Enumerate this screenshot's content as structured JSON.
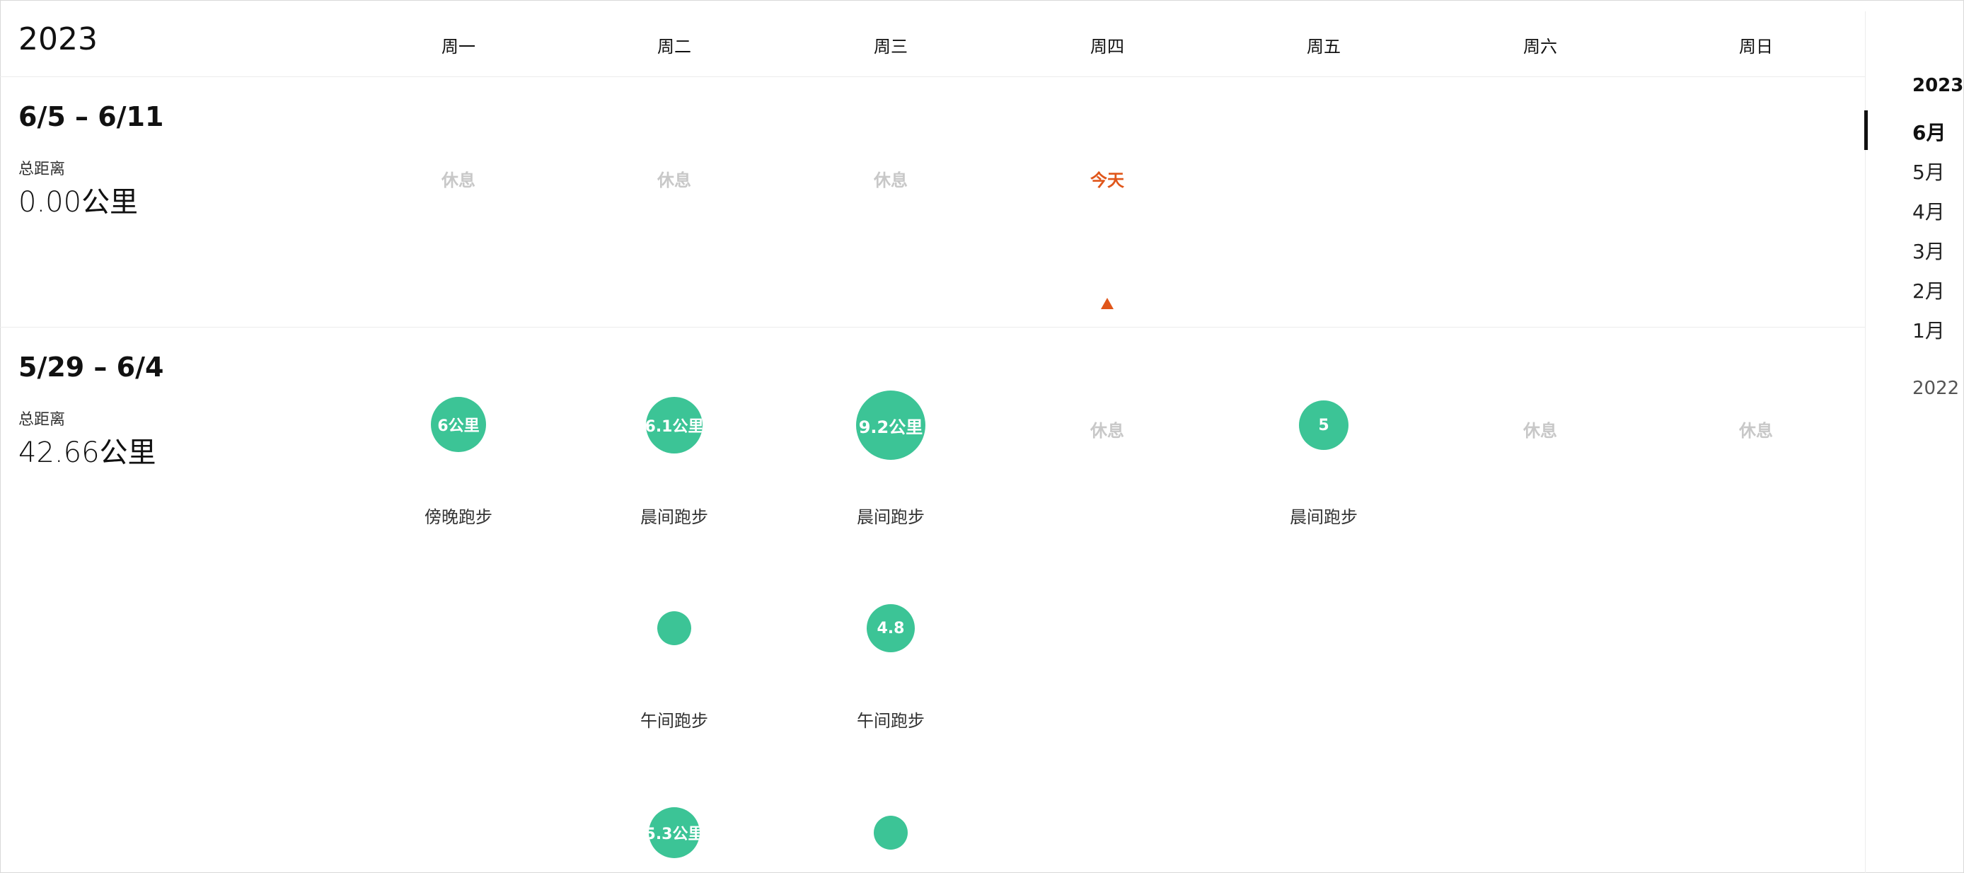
{
  "header": {
    "year": "2023",
    "days": [
      "周一",
      "周二",
      "周三",
      "周四",
      "周五",
      "周六",
      "周日"
    ]
  },
  "weeks": [
    {
      "range": "6/5 – 6/11",
      "distance_label": "总距离",
      "distance": "0.00公里",
      "cells": {
        "mon": "休息",
        "tue": "休息",
        "wed": "休息",
        "thu": "今天"
      }
    },
    {
      "range": "5/29 – 6/4",
      "distance_label": "总距离",
      "distance": "42.66公里",
      "cells": {
        "thu": "休息",
        "sat": "休息",
        "sun": "休息"
      },
      "activities": [
        {
          "day": "周一",
          "bubble": "6公里",
          "label": "傍晚跑步"
        },
        {
          "day": "周二",
          "bubble": "6.1公里",
          "label": "晨间跑步"
        },
        {
          "day": "周三",
          "bubble": "9.2公里",
          "label": "晨间跑步"
        },
        {
          "day": "周五",
          "bubble": "5",
          "label": "晨间跑步"
        },
        {
          "day": "周二",
          "bubble": "",
          "label": "午间跑步"
        },
        {
          "day": "周三",
          "bubble": "4.8",
          "label": "午间跑步"
        },
        {
          "day": "周二",
          "bubble": "5.3公里",
          "label": ""
        },
        {
          "day": "周三",
          "bubble": "",
          "label": ""
        }
      ]
    }
  ],
  "sidebar": {
    "year": "2023",
    "months": [
      "6月",
      "5月",
      "4月",
      "3月",
      "2月",
      "1月"
    ],
    "active_month": "6月",
    "prev_year": "2022"
  },
  "colors": {
    "bubble": "#3cc496",
    "today": "#e0561a",
    "rest": "#c8c8c8"
  }
}
